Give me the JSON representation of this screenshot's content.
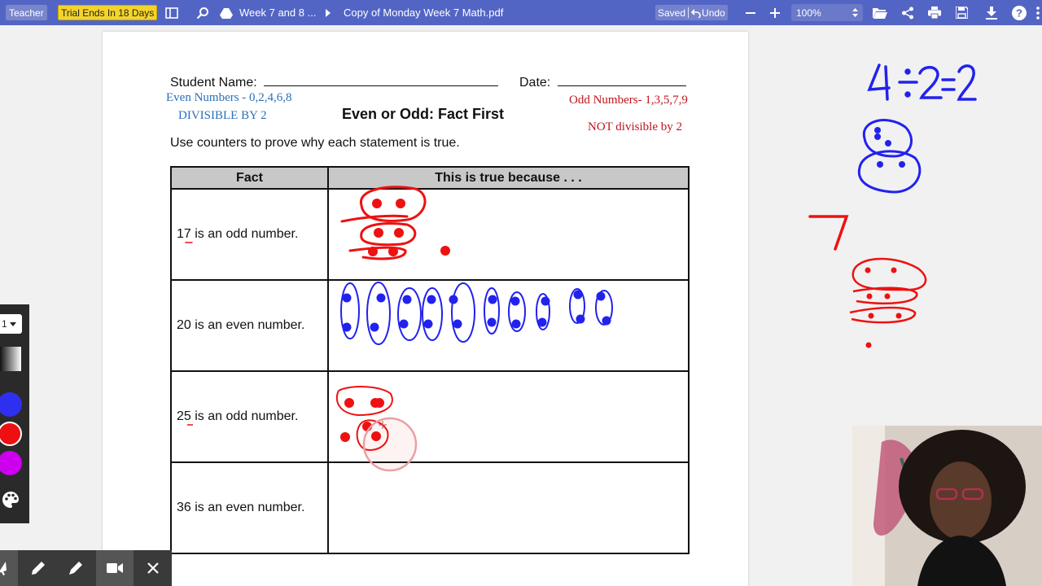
{
  "toolbar": {
    "teacher_label": "Teacher",
    "trial_label": "Trial Ends In 18 Days",
    "breadcrumb_folder": "Week 7 and 8 ...",
    "breadcrumb_file": "Copy of Monday Week 7 Math.pdf",
    "saved_label": "Saved",
    "undo_label": "Undo",
    "zoom_value": "100%",
    "colors": {
      "bar": "#5365c4",
      "trial_badge": "#f5d42a"
    }
  },
  "document": {
    "student_name_label": "Student Name:",
    "date_label": "Date:",
    "even_numbers_note": "Even Numbers - 0,2,4,6,8",
    "divisible_note": "DIVISIBLE BY 2",
    "title": "Even or Odd: Fact First",
    "odd_numbers_note": "Odd Numbers- 1,3,5,7,9",
    "not_divisible_note": "NOT divisible by 2",
    "instructions": "Use counters to prove why each statement is true.",
    "table": {
      "headers": [
        "Fact",
        "This is true because . . ."
      ],
      "rows": [
        {
          "fact": "17 is an odd number."
        },
        {
          "fact": "20 is an even number."
        },
        {
          "fact": "25 is an odd number."
        },
        {
          "fact": "36 is an even number."
        }
      ]
    }
  },
  "annotations": {
    "equation": "4÷2=2",
    "seven": "7",
    "ink_colors": {
      "blue": "#2222ee",
      "red": "#ee1111"
    }
  },
  "tools": {
    "size_value": "1",
    "color_swatches": [
      "#2f2ff0",
      "#ee1010",
      "#cc00ee"
    ]
  }
}
